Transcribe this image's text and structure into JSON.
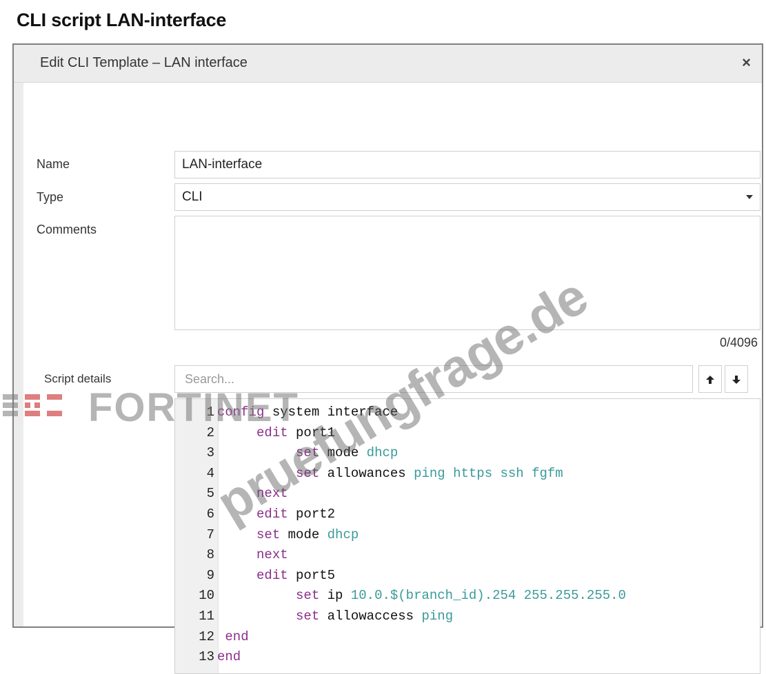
{
  "page": {
    "title": "CLI script LAN-interface"
  },
  "dialog": {
    "title": "Edit CLI Template – LAN interface",
    "close_icon": "close-icon"
  },
  "form": {
    "name_label": "Name",
    "name_value": "LAN-interface",
    "type_label": "Type",
    "type_value": "CLI",
    "comments_label": "Comments",
    "comments_value": "",
    "comments_counter": "0/4096",
    "script_label": "Script details",
    "search_placeholder": "Search..."
  },
  "script": {
    "lines": [
      {
        "n": "1",
        "parts": [
          [
            "kw",
            "config"
          ],
          [
            "pl",
            " system interface"
          ]
        ]
      },
      {
        "n": "2",
        "parts": [
          [
            "pl",
            "     "
          ],
          [
            "kw",
            "edit"
          ],
          [
            "pl",
            " port1"
          ]
        ]
      },
      {
        "n": "3",
        "parts": [
          [
            "pl",
            "          "
          ],
          [
            "kw",
            "set"
          ],
          [
            "pl",
            " mode "
          ],
          [
            "val",
            "dhcp"
          ]
        ]
      },
      {
        "n": "4",
        "parts": [
          [
            "pl",
            "          "
          ],
          [
            "kw",
            "set"
          ],
          [
            "pl",
            " allowances "
          ],
          [
            "val",
            "ping https ssh fgfm"
          ]
        ]
      },
      {
        "n": "5",
        "parts": [
          [
            "pl",
            "     "
          ],
          [
            "kw",
            "next"
          ]
        ]
      },
      {
        "n": "6",
        "parts": [
          [
            "pl",
            "     "
          ],
          [
            "kw",
            "edit"
          ],
          [
            "pl",
            " port2"
          ]
        ]
      },
      {
        "n": "7",
        "parts": [
          [
            "pl",
            "     "
          ],
          [
            "kw",
            "set"
          ],
          [
            "pl",
            " mode "
          ],
          [
            "val",
            "dhcp"
          ]
        ]
      },
      {
        "n": "8",
        "parts": [
          [
            "pl",
            "     "
          ],
          [
            "kw",
            "next"
          ]
        ]
      },
      {
        "n": "9",
        "parts": [
          [
            "pl",
            "     "
          ],
          [
            "kw",
            "edit"
          ],
          [
            "pl",
            " port5"
          ]
        ]
      },
      {
        "n": "10",
        "parts": [
          [
            "pl",
            "          "
          ],
          [
            "kw",
            "set"
          ],
          [
            "pl",
            " ip "
          ],
          [
            "val",
            "10.0.$(branch_id).254 255.255.255.0"
          ]
        ]
      },
      {
        "n": "11",
        "parts": [
          [
            "pl",
            "          "
          ],
          [
            "kw",
            "set"
          ],
          [
            "pl",
            " allowaccess "
          ],
          [
            "val",
            "ping"
          ]
        ]
      },
      {
        "n": "12",
        "parts": [
          [
            "pl",
            " "
          ],
          [
            "kw",
            "end"
          ]
        ]
      },
      {
        "n": "13",
        "parts": [
          [
            "kw",
            "end"
          ]
        ]
      }
    ]
  },
  "overlay": {
    "watermark": "pruefungfrage.de",
    "logo": "FORTINET"
  }
}
